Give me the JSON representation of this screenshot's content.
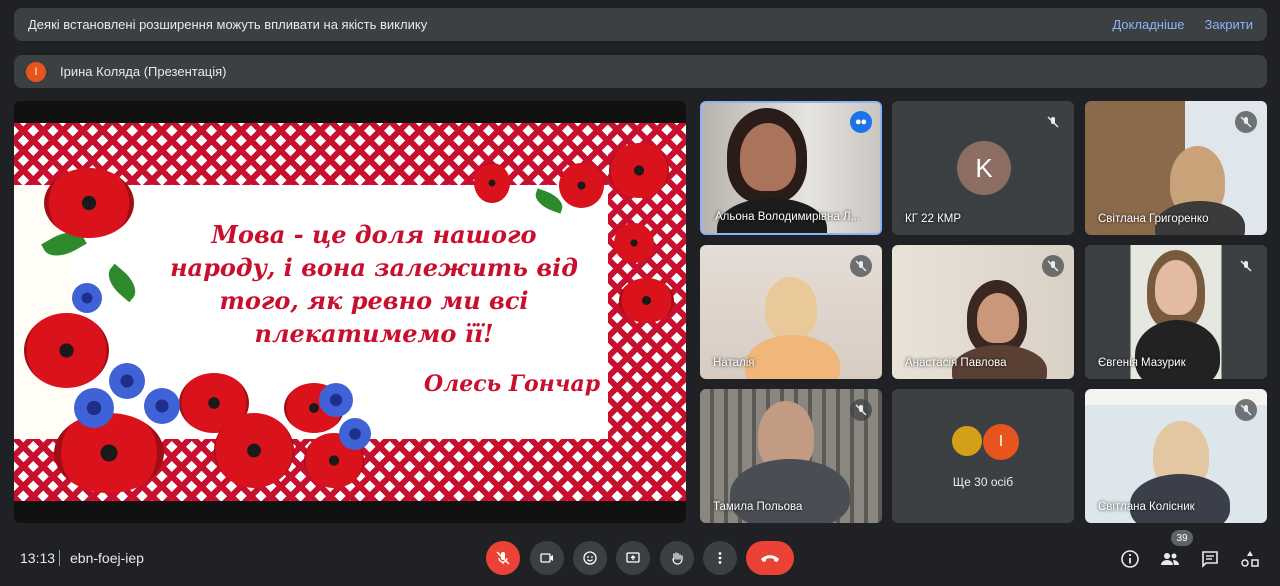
{
  "banner": {
    "message": "Деякі встановлені розширення можуть впливати на якість виклику",
    "more_label": "Докладніше",
    "close_label": "Закрити"
  },
  "presentation": {
    "avatar_letter": "І",
    "title": "Ірина Коляда (Презентація)"
  },
  "slide": {
    "quote_line1": "Мова - це доля нашого",
    "quote_line2": "народу, і вона залежить від",
    "quote_line3": "того, як ревно ми всі",
    "quote_line4": "плекатимемо її!",
    "author": "Олесь Гончар"
  },
  "tiles": [
    {
      "name": "Альона Володимирівна Л..."
    },
    {
      "name": "КГ 22 КМР",
      "avatar_letter": "K"
    },
    {
      "name": "Світлана Григоренко"
    },
    {
      "name": "Наталія"
    },
    {
      "name": "Анастасія Павлова"
    },
    {
      "name": "Євгенія Мазурик"
    },
    {
      "name": "Тамила Польова"
    },
    {
      "name": "Ще 30 осіб",
      "avatar_letter": "І"
    },
    {
      "name": "Світлана Колісник"
    }
  ],
  "footer": {
    "time": "13:13",
    "meeting_code": "ebn-foej-iep",
    "participants_count": "39"
  },
  "colors": {
    "end_call": "#ea4335",
    "accent": "#8ab4f8",
    "speaking": "#1a73e8"
  }
}
